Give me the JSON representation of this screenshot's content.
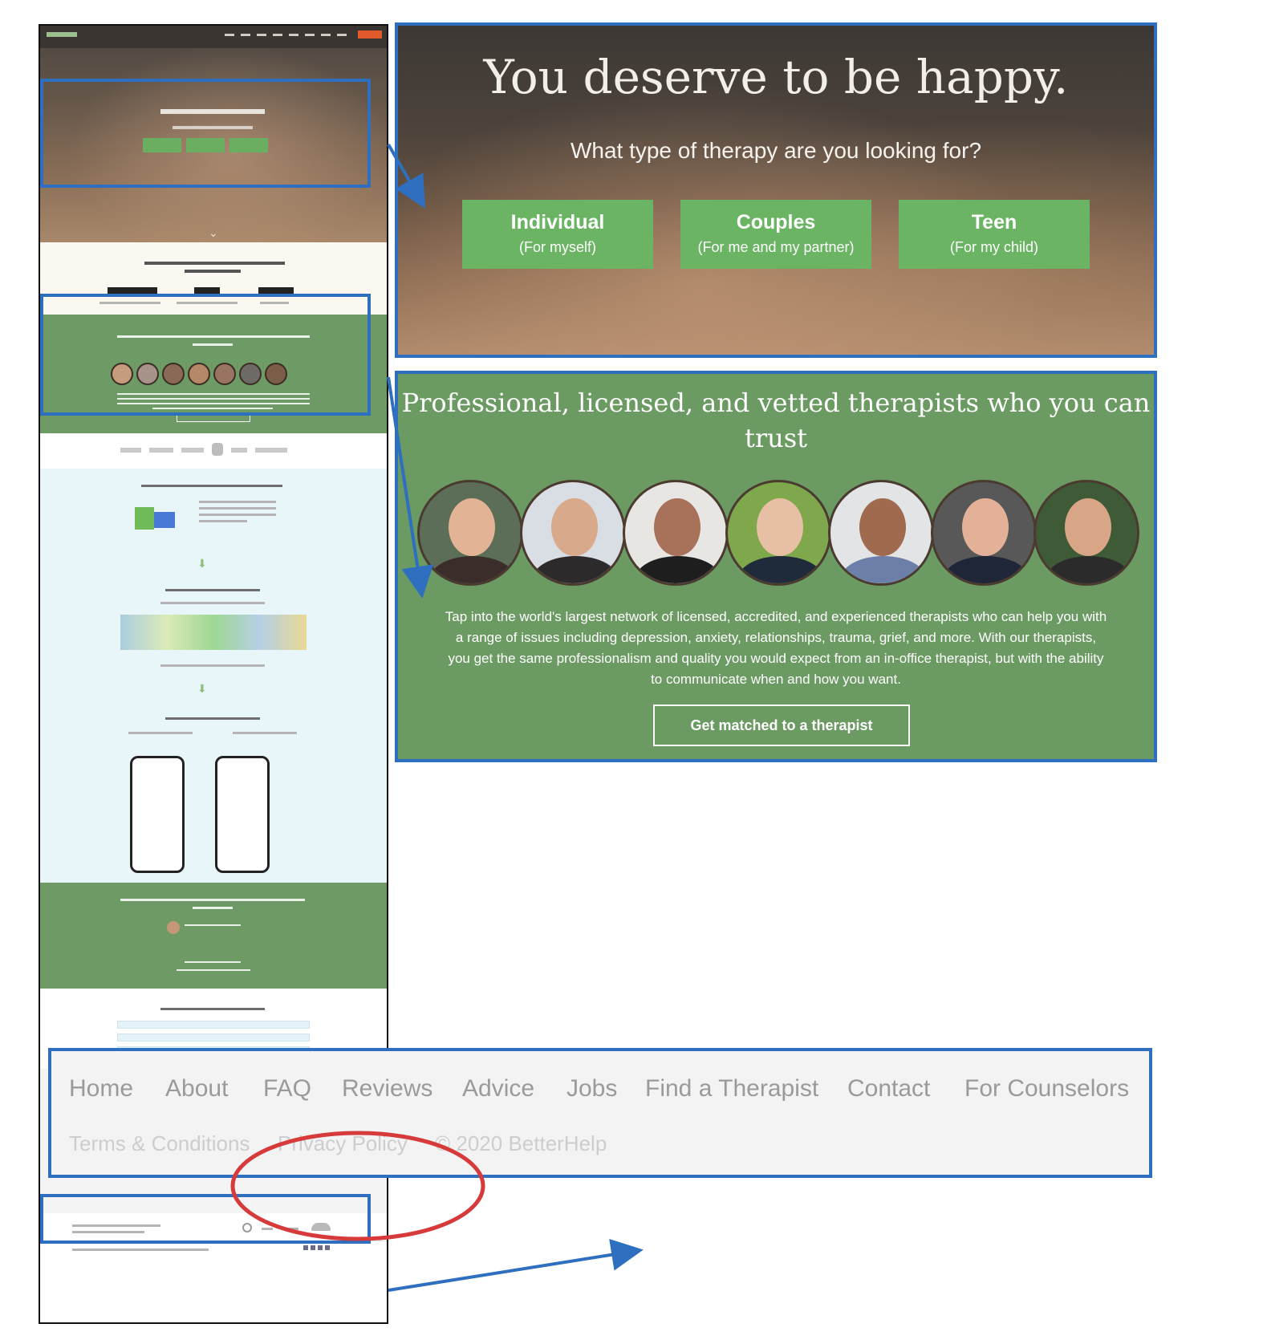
{
  "hero": {
    "title": "You deserve to be happy.",
    "question": "What type of therapy are you looking for?",
    "buttons": [
      {
        "label": "Individual",
        "sub": "(For myself)"
      },
      {
        "label": "Couples",
        "sub": "(For me and my partner)"
      },
      {
        "label": "Teen",
        "sub": "(For my child)"
      }
    ]
  },
  "therapists": {
    "title": "Professional, licensed, and vetted therapists who you can trust",
    "body": "Tap into the world's largest network of licensed, accredited, and experienced therapists who can help you with a range of issues including depression, anxiety, relationships, trauma, grief, and more. With our therapists, you get the same professionalism and quality you would expect from an in-office therapist, but with the ability to communicate when and how you want.",
    "cta": "Get matched to a therapist",
    "avatar_count": 7
  },
  "footer": {
    "nav": [
      "Home",
      "About",
      "FAQ",
      "Reviews",
      "Advice",
      "Jobs",
      "Find a Therapist",
      "Contact",
      "For Counselors"
    ],
    "legal": [
      "Terms & Conditions",
      "Privacy Policy",
      "© 2020 BetterHelp"
    ]
  },
  "colors": {
    "highlight": "#2e6fc0",
    "green": "#6c9a63",
    "button_green": "#6ab464",
    "annotation": "#d63a3a"
  }
}
